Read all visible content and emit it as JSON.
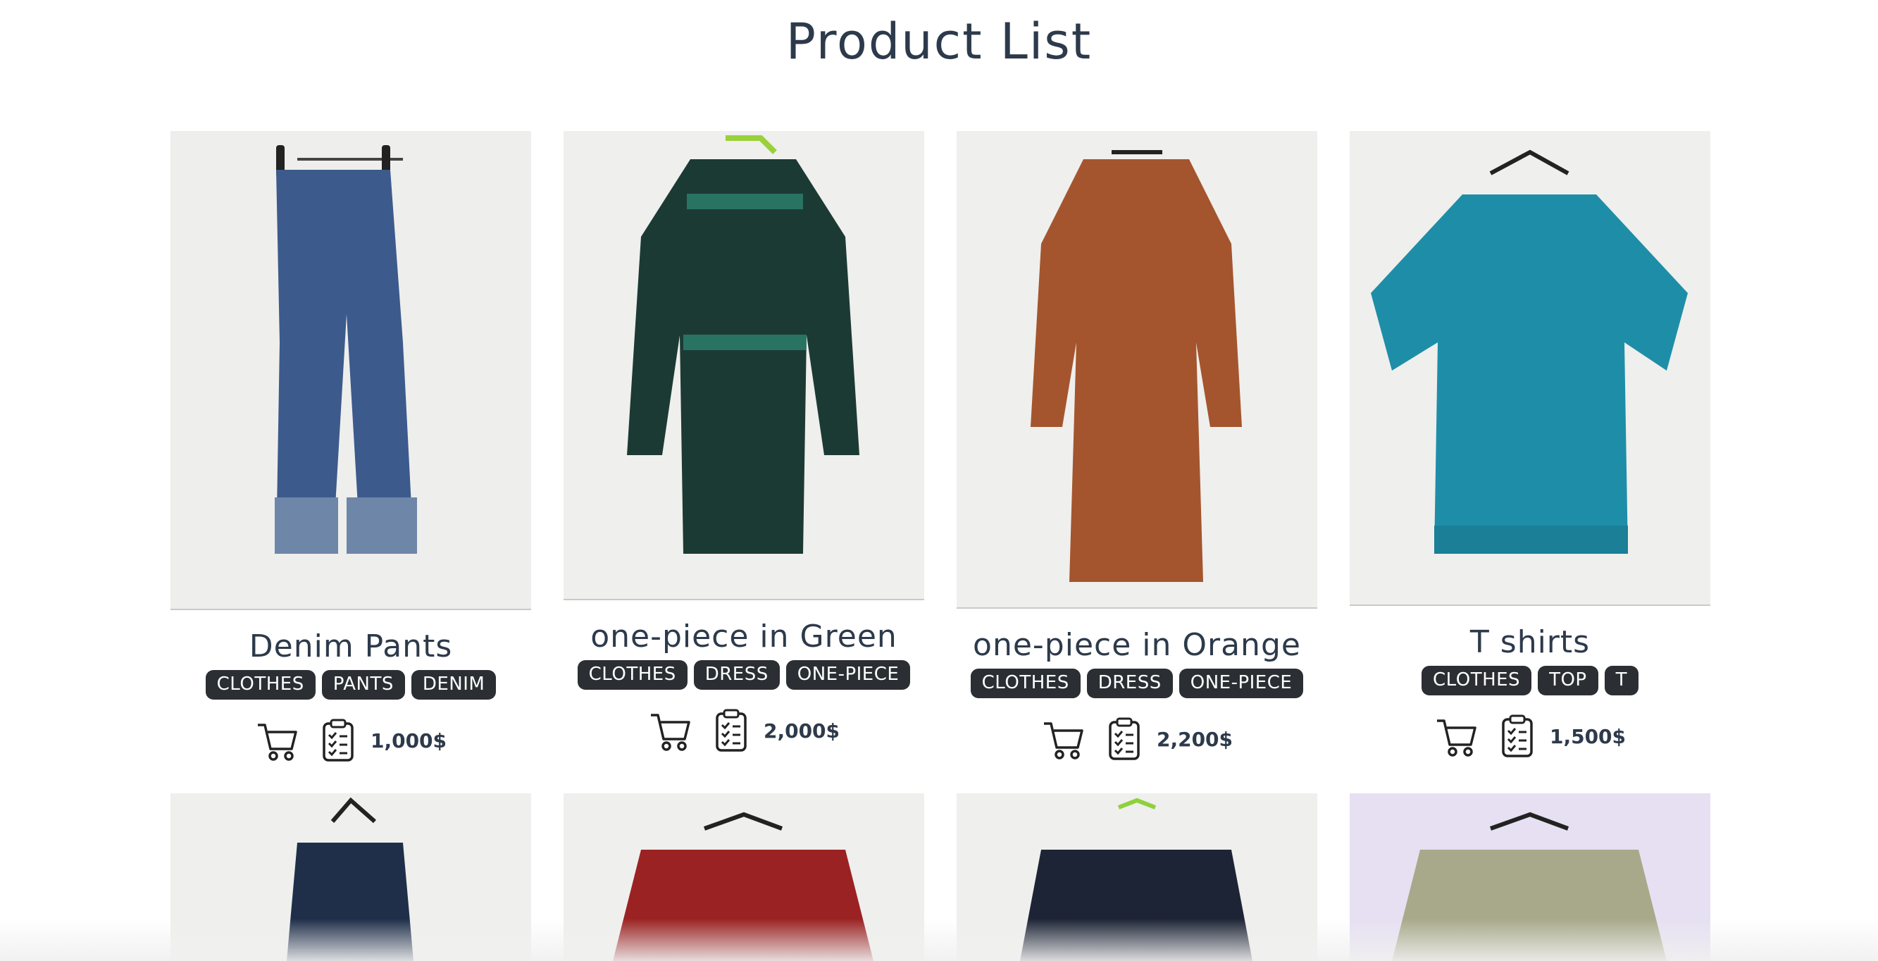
{
  "header": {
    "title": "Product List"
  },
  "icons": {
    "cart": "cart-icon",
    "detail": "clipboard-checklist-icon"
  },
  "colors": {
    "tag_bg": "#2b2f33",
    "text": "#2d3a4b"
  },
  "products": [
    {
      "name": "Denim Pants",
      "tags": [
        "CLOTHES",
        "PANTS",
        "DENIM"
      ],
      "price": "1,000$"
    },
    {
      "name": "one-piece in Green",
      "tags": [
        "CLOTHES",
        "DRESS",
        "ONE-PIECE"
      ],
      "price": "2,000$"
    },
    {
      "name": "one-piece in Orange",
      "tags": [
        "CLOTHES",
        "DRESS",
        "ONE-PIECE"
      ],
      "price": "2,200$"
    },
    {
      "name": "T shirts",
      "tags": [
        "CLOTHES",
        "TOP",
        "T"
      ],
      "price": "1,500$"
    }
  ]
}
